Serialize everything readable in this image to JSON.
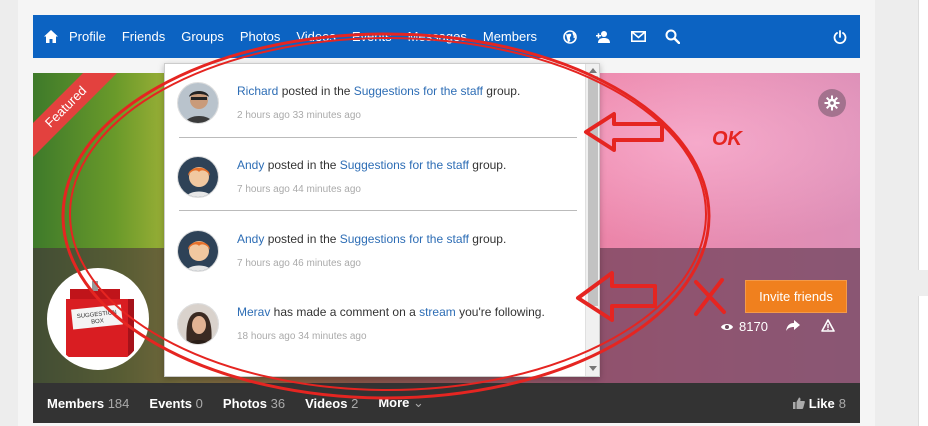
{
  "navbar": {
    "items": [
      "Profile",
      "Friends",
      "Groups",
      "Photos",
      "Videos",
      "Events",
      "Messages",
      "Members"
    ],
    "icons": [
      "home-icon",
      "globe-icon",
      "user-add-icon",
      "envelope-icon",
      "search-icon",
      "power-icon"
    ],
    "bg_color": "#0c63c2"
  },
  "cover": {
    "ribbon": "Featured",
    "invite_label": "Invite friends",
    "views": "8170"
  },
  "notifications": [
    {
      "actor": "Richard",
      "pre": " posted in the ",
      "link": "Suggestions for the staff",
      "post": " group.",
      "time": "2 hours ago 33 minutes ago"
    },
    {
      "actor": "Andy",
      "pre": " posted in the ",
      "link": "Suggestions for the staff",
      "post": " group.",
      "time": "7 hours ago 44 minutes ago"
    },
    {
      "actor": "Andy",
      "pre": " posted in the ",
      "link": "Suggestions for the staff",
      "post": " group.",
      "time": "7 hours ago 46 minutes ago"
    },
    {
      "actor": "Merav",
      "pre": " has made a comment on a ",
      "link": "stream",
      "post": " you're following.",
      "time": "18 hours ago 34 minutes ago"
    }
  ],
  "subnav": {
    "items": [
      {
        "label": "Members",
        "count": "184"
      },
      {
        "label": "Events",
        "count": "0"
      },
      {
        "label": "Photos",
        "count": "36"
      },
      {
        "label": "Videos",
        "count": "2"
      },
      {
        "label": "More",
        "count": ""
      }
    ],
    "like_label": "Like",
    "like_count": "8"
  },
  "annotation": {
    "ok_label": "OK",
    "color": "#e52521"
  }
}
